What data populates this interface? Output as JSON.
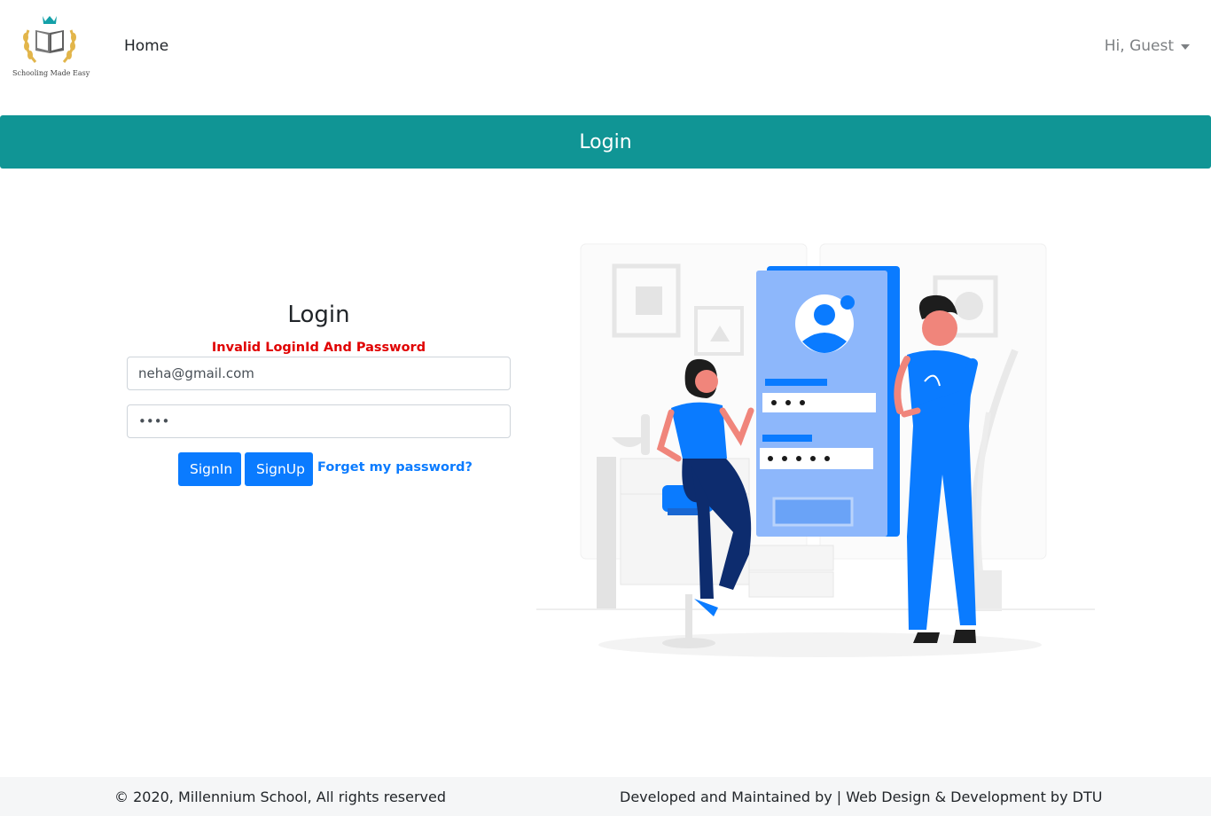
{
  "navbar": {
    "logo_caption": "Schooling Made Easy",
    "home_label": "Home",
    "user_label": "Hi, Guest"
  },
  "banner": {
    "title": "Login"
  },
  "login": {
    "heading": "Login",
    "error": "Invalid LoginId And Password",
    "email_value": "neha@gmail.com",
    "password_value": "1234",
    "signin_label": "SignIn",
    "signup_label": "SignUp",
    "forgot_label": "Forget my password?"
  },
  "footer": {
    "left": "© 2020, Millennium School, All rights reserved",
    "right": "Developed and Maintained by | Web Design & Development by DTU"
  },
  "colors": {
    "banner": "#109595",
    "primary": "#0a7bff",
    "error": "#e00000",
    "footer_bg": "#f5f6f7"
  },
  "icons": [
    "school-logo-icon",
    "caret-down-icon",
    "login-illustration"
  ]
}
